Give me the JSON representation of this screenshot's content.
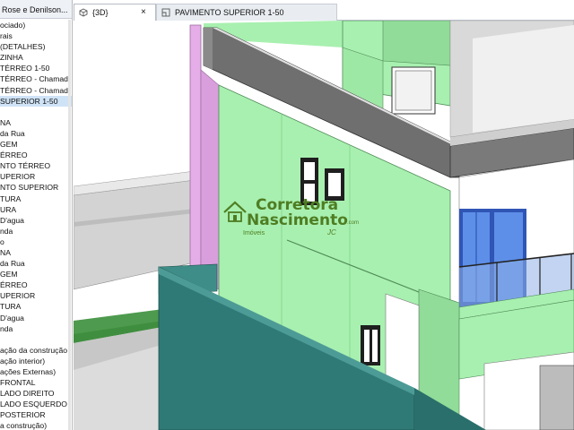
{
  "project_browser": {
    "header": "Rose e Denilson...",
    "items": [
      {
        "label": "ociado)"
      },
      {
        "label": "rais"
      },
      {
        "label": "(DETALHES)"
      },
      {
        "label": "ZINHA"
      },
      {
        "label": "TÉRREO 1-50"
      },
      {
        "label": "TÉRREO - Chamad"
      },
      {
        "label": "TÉRREO - Chamad"
      },
      {
        "label": "SUPERIOR 1-50",
        "selected": true
      },
      {
        "label": ""
      },
      {
        "label": "NA"
      },
      {
        "label": "da Rua"
      },
      {
        "label": "GEM"
      },
      {
        "label": "ÉRREO"
      },
      {
        "label": "NTO TÉRREO"
      },
      {
        "label": "UPERIOR"
      },
      {
        "label": "NTO SUPERIOR"
      },
      {
        "label": "TURA"
      },
      {
        "label": "URA"
      },
      {
        "label": "D'agua"
      },
      {
        "label": "nda"
      },
      {
        "label": "o"
      },
      {
        "label": "NA"
      },
      {
        "label": "da Rua"
      },
      {
        "label": "GEM"
      },
      {
        "label": "ÉRREO"
      },
      {
        "label": "UPERIOR"
      },
      {
        "label": "TURA"
      },
      {
        "label": "D'agua"
      },
      {
        "label": "nda"
      },
      {
        "label": ""
      },
      {
        "label": "ação da construção"
      },
      {
        "label": "ação interior)"
      },
      {
        "label": "ações Externas)"
      },
      {
        "label": "FRONTAL"
      },
      {
        "label": "LADO DIREITO"
      },
      {
        "label": "LADO ESQUERDO"
      },
      {
        "label": "POSTERIOR"
      },
      {
        "label": "a construção)"
      }
    ]
  },
  "tabs": [
    {
      "label": "{3D}",
      "icon": "cube-3d-icon",
      "active": true,
      "close": "×"
    },
    {
      "label": "PAVIMENTO SUPERIOR 1-50",
      "icon": "floor-plan-icon",
      "active": false
    }
  ],
  "watermark": {
    "line1": "Corretora",
    "line2": "Nascimento",
    "dotcom": ".com",
    "sub": "Imóveis",
    "signature": "JC"
  },
  "colors": {
    "wall_green": "#a8f0b0",
    "wall_green_dark": "#90dc98",
    "wall_green_shade": "#7fcf88",
    "roof_gray": "#6f6f6f",
    "teal_fence": "#2f7a76",
    "pink_wall": "#e5aee8",
    "glass_blue": "#4f8fe6",
    "terrain_green": "#3f8e3f",
    "watermark_green": "#4e7d22"
  }
}
